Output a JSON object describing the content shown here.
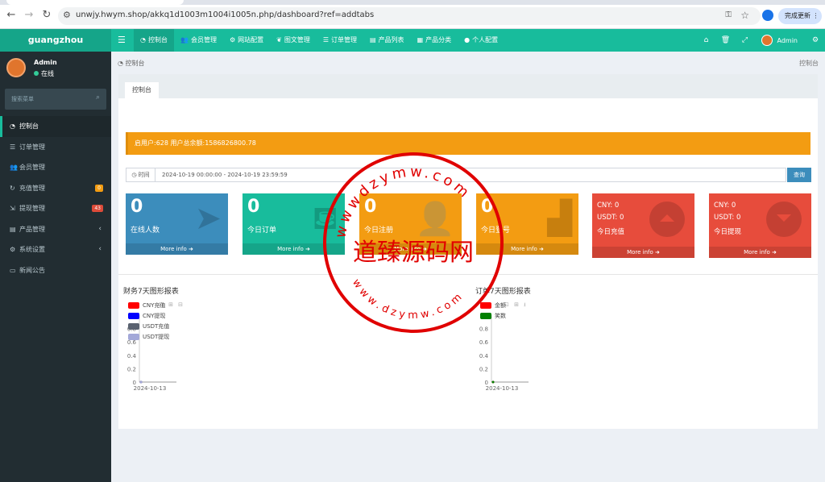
{
  "browser": {
    "url": "unwjy.hwym.shop/akkq1d1003m1004i1005n.php/dashboard?ref=addtabs",
    "update_label": "完成更新"
  },
  "topbar": {
    "logo": "guangzhou",
    "nav": [
      {
        "icon": "dashboard-icon",
        "label": "控制台"
      },
      {
        "icon": "users-icon",
        "label": "会员管理"
      },
      {
        "icon": "gear-icon",
        "label": "网站配置"
      },
      {
        "icon": "leaf-icon",
        "label": "图文管理"
      },
      {
        "icon": "list-icon",
        "label": "订单管理"
      },
      {
        "icon": "shop-icon",
        "label": "产品列表"
      },
      {
        "icon": "table-icon",
        "label": "产品分类"
      },
      {
        "icon": "user-icon",
        "label": "个人配置"
      }
    ],
    "username": "Admin"
  },
  "sidebar": {
    "user": {
      "name": "Admin",
      "status": "在线"
    },
    "search_placeholder": "搜索菜单",
    "items": [
      {
        "icon": "dashboard-icon",
        "label": "控制台"
      },
      {
        "icon": "list-icon",
        "label": "订单管理"
      },
      {
        "icon": "users-icon",
        "label": "会员管理"
      },
      {
        "icon": "recharge-icon",
        "label": "充值管理",
        "badge": "0",
        "badge_color": "#f39c12"
      },
      {
        "icon": "withdraw-icon",
        "label": "提现管理",
        "badge": "43",
        "badge_color": "#dd4b39"
      },
      {
        "icon": "shop-icon",
        "label": "产品管理",
        "arrow": "‹"
      },
      {
        "icon": "cogs-icon",
        "label": "系统设置",
        "arrow": "‹"
      },
      {
        "icon": "news-icon",
        "label": "新闻公告"
      }
    ]
  },
  "breadcrumb": {
    "left": "控制台",
    "right": "控制台"
  },
  "tab": "控制台",
  "alert": "启用户:628    用户总余额:1586826800.78",
  "filter": {
    "label": "时间",
    "value": "2024-10-19 00:00:00 - 2024-10-19 23:59:59",
    "button": "查询"
  },
  "cards": [
    {
      "num": "0",
      "label": "在线人数",
      "footer": "More info ➜",
      "color": "#3c8dbc"
    },
    {
      "num": "0",
      "label": "今日订单",
      "footer": "More info ➜",
      "color": "#18bc9c"
    },
    {
      "num": "0",
      "label": "今日注册",
      "footer": "More info ➜",
      "color": "#f39c12"
    },
    {
      "num": "0",
      "label": "今日登号",
      "footer": "More info ➜",
      "color": "#f39c12"
    },
    {
      "l1": "CNY:  0",
      "l2": "USDT:  0",
      "l3": "今日充值",
      "footer": "More info ➜",
      "color": "#e74c3c"
    },
    {
      "l1": "CNY:  0",
      "l2": "USDT:  0",
      "l3": "今日提现",
      "footer": "More info ➜",
      "color": "#e74c3c"
    }
  ],
  "chart_data": [
    {
      "type": "line",
      "title": "财务7天图形报表",
      "categories": [
        "2024-10-13"
      ],
      "series": [
        {
          "name": "CNY充值",
          "color": "#ff0000",
          "values": [
            0
          ]
        },
        {
          "name": "CNY提现",
          "color": "#0000ff",
          "values": [
            0
          ]
        },
        {
          "name": "USDT充值",
          "color": "#5a6270",
          "values": [
            0
          ]
        },
        {
          "name": "USDT提现",
          "color": "#a3a8d8",
          "values": [
            0
          ]
        }
      ],
      "y_ticks": [
        "0",
        "0.2",
        "0.4",
        "0.6",
        "0.8"
      ],
      "ylim": [
        0,
        1
      ]
    },
    {
      "type": "line",
      "title": "订单7天图形报表",
      "categories": [
        "2024-10-13"
      ],
      "series": [
        {
          "name": "金额",
          "color": "#ff0000",
          "values": [
            0
          ]
        },
        {
          "name": "笑数",
          "color": "#008000",
          "values": [
            0
          ]
        }
      ],
      "y_ticks": [
        "0",
        "0.2",
        "0.4",
        "0.6",
        "0.8"
      ],
      "ylim": [
        0,
        1
      ]
    }
  ],
  "stamp": {
    "center": "道臻源码网",
    "top_arc": "wwwdzymw.com",
    "bottom_arc": "www.dzymw.com",
    "color": "#e00000"
  }
}
